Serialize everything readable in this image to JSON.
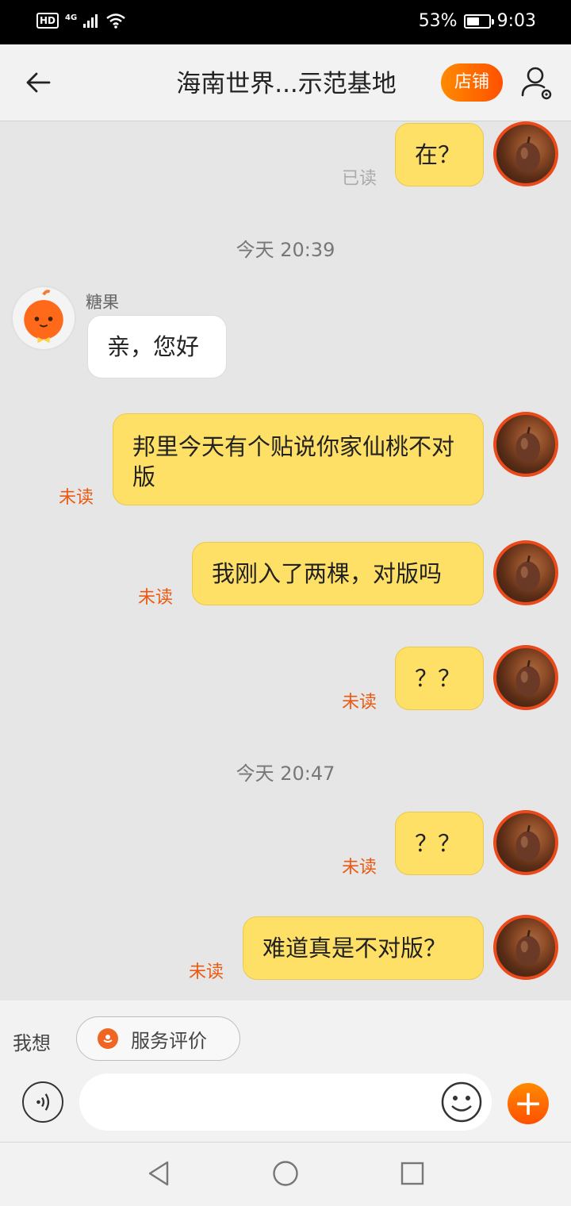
{
  "status_bar": {
    "hd": "HD",
    "network": "4G",
    "battery_percent": "53%",
    "time": "9:03"
  },
  "header": {
    "title": "海南世界...示范基地",
    "shop_button": "店铺"
  },
  "timestamps": [
    "今天  20:39",
    "今天  20:47"
  ],
  "sender_name": "糖果",
  "messages": [
    {
      "text": "在？",
      "status": "已读"
    },
    {
      "text": "亲，您好"
    },
    {
      "text": "邦里今天有个贴说你家仙桃不对版",
      "status": "未读"
    },
    {
      "text": "我刚入了两棵，对版吗",
      "status": "未读"
    },
    {
      "text": "？？",
      "status": "未读"
    },
    {
      "text": "？？",
      "status": "未读"
    },
    {
      "text": "难道真是不对版？",
      "status": "未读"
    }
  ],
  "quick_bar": {
    "label": "我想",
    "chip": "服务评价"
  },
  "input": {
    "placeholder": ""
  },
  "icons": {
    "back": "back-arrow-icon",
    "user_settings": "user-settings-icon",
    "voice": "voice-icon",
    "emoji": "emoji-icon",
    "plus": "plus-icon",
    "nav_back": "nav-back-icon",
    "nav_home": "nav-home-icon",
    "nav_recent": "nav-recent-icon"
  },
  "colors": {
    "accent": "#ff5000",
    "my_bubble": "#ffe066",
    "unread": "#ea5a12"
  }
}
